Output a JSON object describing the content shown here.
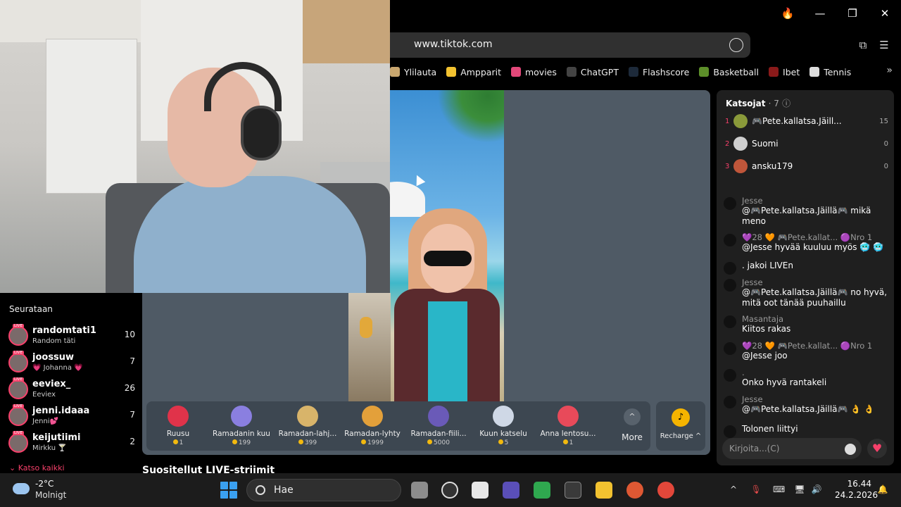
{
  "browser": {
    "url": "www.tiktok.com",
    "bookmarks": [
      {
        "label": "Ylilauta",
        "color": "#c9a76f"
      },
      {
        "label": "Ampparit",
        "color": "#f2c230"
      },
      {
        "label": "movies",
        "color": "#e3487a"
      },
      {
        "label": "ChatGPT",
        "color": "#444444"
      },
      {
        "label": "Flashscore",
        "color": "#1d2a3a"
      },
      {
        "label": "Basketball",
        "color": "#5d8f2a"
      },
      {
        "label": "Ibet",
        "color": "#8a1a1a"
      },
      {
        "label": "Tennis",
        "color": "#dddddd"
      }
    ],
    "more_glyph": "»"
  },
  "gifts": [
    {
      "name": "Ruusu",
      "price": "1",
      "color": "#e0334a"
    },
    {
      "name": "Ramadanin kuu",
      "price": "199",
      "color": "#8a7fe0"
    },
    {
      "name": "Ramadan-lahj...",
      "price": "399",
      "color": "#d8b46a"
    },
    {
      "name": "Ramadan-lyhty",
      "price": "1999",
      "color": "#e3a03a"
    },
    {
      "name": "Ramadan-fiili...",
      "price": "5000",
      "color": "#6a5ab8"
    },
    {
      "name": "Kuun katselu",
      "price": "5",
      "color": "#cfd8e6"
    },
    {
      "name": "Anna lentosu...",
      "price": "1",
      "color": "#e84a5a"
    }
  ],
  "gift_more": {
    "label": "More",
    "glyph": "^"
  },
  "recharge": {
    "label": "Recharge ^",
    "glyph": "♪"
  },
  "recommended_heading": "Suositellut LIVE-striimit",
  "viewers": {
    "title": "Katsojat",
    "count": "· 7",
    "list": [
      {
        "rank": "1",
        "name": "🎮Pete.kallatsa.Jäill...",
        "score": "15",
        "color": "#8a9a3a"
      },
      {
        "rank": "2",
        "name": "Suomi",
        "score": "0",
        "color": "#cfcfcf"
      },
      {
        "rank": "3",
        "name": "ansku179",
        "score": "0",
        "color": "#c0563a"
      }
    ]
  },
  "chat": [
    {
      "author": "Jesse",
      "text": "@🎮Pete.kallatsa.Jäillä🎮 mikä meno"
    },
    {
      "author": "💜28 🧡 🎮Pete.kallat... 🟣Nro 1",
      "text": "@Jesse hyvää kuuluu myös 🥶 🥶"
    },
    {
      "author": "",
      "text": ".  jakoi LIVEn"
    },
    {
      "author": "Jesse",
      "text": "@🎮Pete.kallatsa.Jäillä🎮 no hyvä, mitä oot tänää puuhaillu"
    },
    {
      "author": "Masantaja",
      "text": "Kiitos rakas"
    },
    {
      "author": "💜28 🧡 🎮Pete.kallat... 🟣Nro 1",
      "text": "@Jesse joo"
    },
    {
      "author": ".",
      "text": "Onko hyvä rantakeli"
    },
    {
      "author": "Jesse",
      "text": "@🎮Pete.kallatsa.Jäillä🎮 👌 👌"
    },
    {
      "author": "",
      "text": "Tolonen  liittyi"
    }
  ],
  "chat_input": {
    "placeholder": "Kirjoita...(C)"
  },
  "following": {
    "title": "Seurataan",
    "live_badge": "LIVE",
    "items": [
      {
        "name": "randomtati1",
        "sub": "Random täti",
        "count": "10"
      },
      {
        "name": "joossuw",
        "sub": "💗 Johanna 💗",
        "count": "7"
      },
      {
        "name": "eeviex_",
        "sub": "Eeviex",
        "count": "26"
      },
      {
        "name": "jenni.idaaa",
        "sub": "Jenni💕",
        "count": "7"
      },
      {
        "name": "keijutiimi",
        "sub": "Mirkku 🍸",
        "count": "2"
      }
    ],
    "see_all": "⌄ Katso kaikki"
  },
  "taskbar": {
    "temperature": "-2°C",
    "condition": "Molnigt",
    "search_label": "Hae",
    "time": "16.44",
    "date": "24.2.2026"
  }
}
